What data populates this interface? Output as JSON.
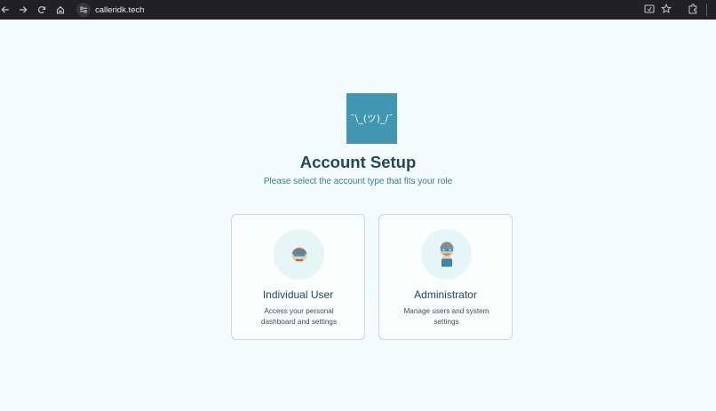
{
  "browser": {
    "url": "calleridk.tech"
  },
  "page": {
    "logo_text": "¯\\_(ツ)_/¯",
    "title": "Account Setup",
    "subtitle": "Please select the account type that fits your role"
  },
  "cards": [
    {
      "title": "Individual User",
      "description": "Access your personal dashboard and settings",
      "icon": "user-avatar-icon"
    },
    {
      "title": "Administrator",
      "description": "Manage users and system settings",
      "icon": "admin-avatar-icon"
    }
  ],
  "colors": {
    "background": "#f2fbfd",
    "logo_bg": "#4196b1",
    "title": "#22495a",
    "subtitle": "#3a7d91",
    "card_border": "#cfd6d9"
  }
}
